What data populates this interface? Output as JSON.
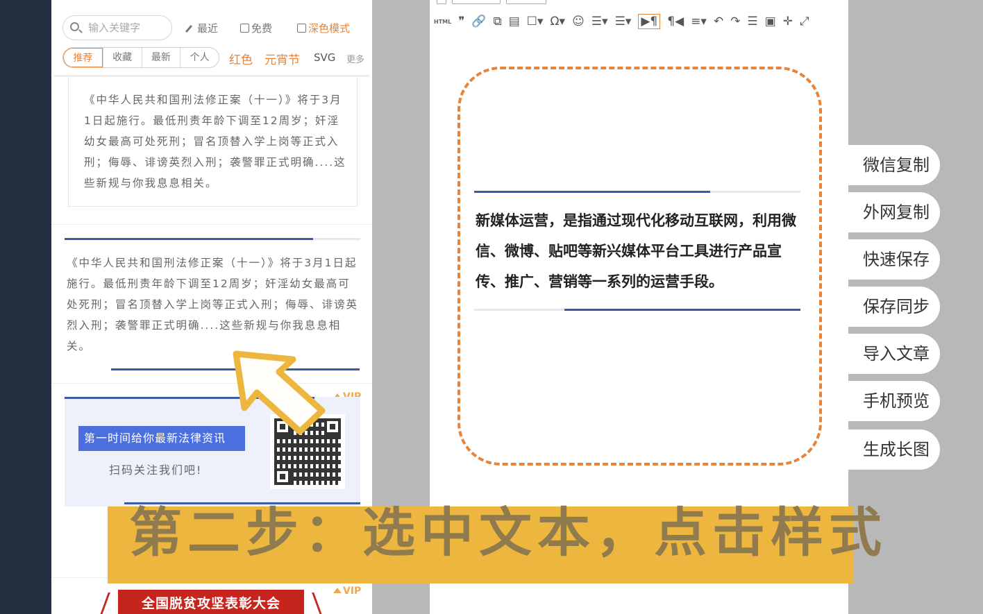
{
  "left": {
    "search_placeholder": "输入关键字",
    "filters": {
      "recent": "最近",
      "free": "免费",
      "dark_mode": "深色模式"
    },
    "tabs": [
      "推荐",
      "收藏",
      "最新",
      "个人"
    ],
    "tags": {
      "red": "红色",
      "lantern": "元宵节",
      "svg": "SVG",
      "more": "更多"
    },
    "card1_text": "《中华人民共和国刑法修正案（十一）》将于3月1日起施行。最低刑责年龄下调至12周岁；奸淫幼女最高可处死刑；冒名顶替入学上岗等正式入刑；侮辱、诽谤英烈入刑；袭警罪正式明确....这些新规与你我息息相关。",
    "card2_text": "《中华人民共和国刑法修正案（十一）》将于3月1日起施行。最低刑责年龄下调至12周岁；奸淫幼女最高可处死刑；冒名顶替入学上岗等正式入刑；侮辱、诽谤英烈入刑；袭警罪正式明确....这些新规与你我息息相关。",
    "vip_label": "VIP",
    "card3_banner": "第一时间给你最新法律资讯",
    "card3_scan": "扫码关注我们吧!",
    "card4_ribbon": "全国脱贫攻坚表彰大会"
  },
  "editor": {
    "toolbar": [
      "HTML",
      "❞",
      "🔗",
      "⧉",
      "▤",
      "☐▾",
      "Ω▾",
      "☺",
      "☰▾",
      "☰▾",
      "▶¶",
      "¶◀",
      "≡▾",
      "↶",
      "↷",
      "☰",
      "▣",
      "✛",
      "⤢"
    ],
    "body_text": "新媒体运营，是指通过现代化移动互联网，利用微信、微博、贴吧等新兴媒体平台工具进行产品宣传、推广、营销等一系列的运营手段。"
  },
  "actions": [
    "微信复制",
    "外网复制",
    "快速保存",
    "保存同步",
    "导入文章",
    "手机预览",
    "生成长图"
  ],
  "caption": "第二步：选中文本，点击样式",
  "colors": {
    "accent": "#e8833a",
    "blue_line": "#3a5aa8",
    "caption_bg": "#edb63f",
    "sidebar_dark": "#243041"
  }
}
